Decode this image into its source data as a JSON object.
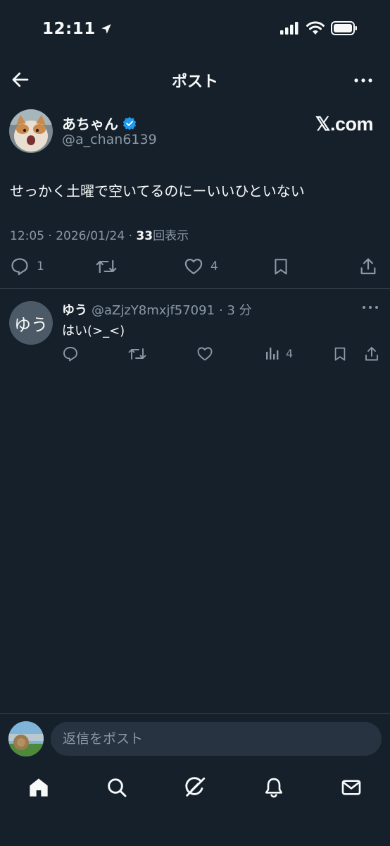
{
  "status_bar": {
    "time": "12:11"
  },
  "header": {
    "title": "ポスト"
  },
  "post": {
    "author_name": "あちゃん",
    "author_handle": "@a_chan6139",
    "watermark": "𝕏.com",
    "text": "せっかく土曜で空いてるのにーいいひといない",
    "timestamp": "12:05 · 2026/01/24 · ",
    "views_count": "33",
    "views_label": "回表示",
    "reply_count": "1",
    "like_count": "4"
  },
  "reply": {
    "avatar_text": "ゆう",
    "name": "ゆう",
    "handle": "@aZjzY8mxjf57091",
    "time": "· 3 分",
    "text": "はい(>_<)",
    "views_count": "4"
  },
  "compose": {
    "placeholder": "返信をポスト"
  },
  "colors": {
    "background": "#15202b",
    "secondary_text": "#8b98a5",
    "verified": "#1d9bf0",
    "divider": "#38444d"
  }
}
